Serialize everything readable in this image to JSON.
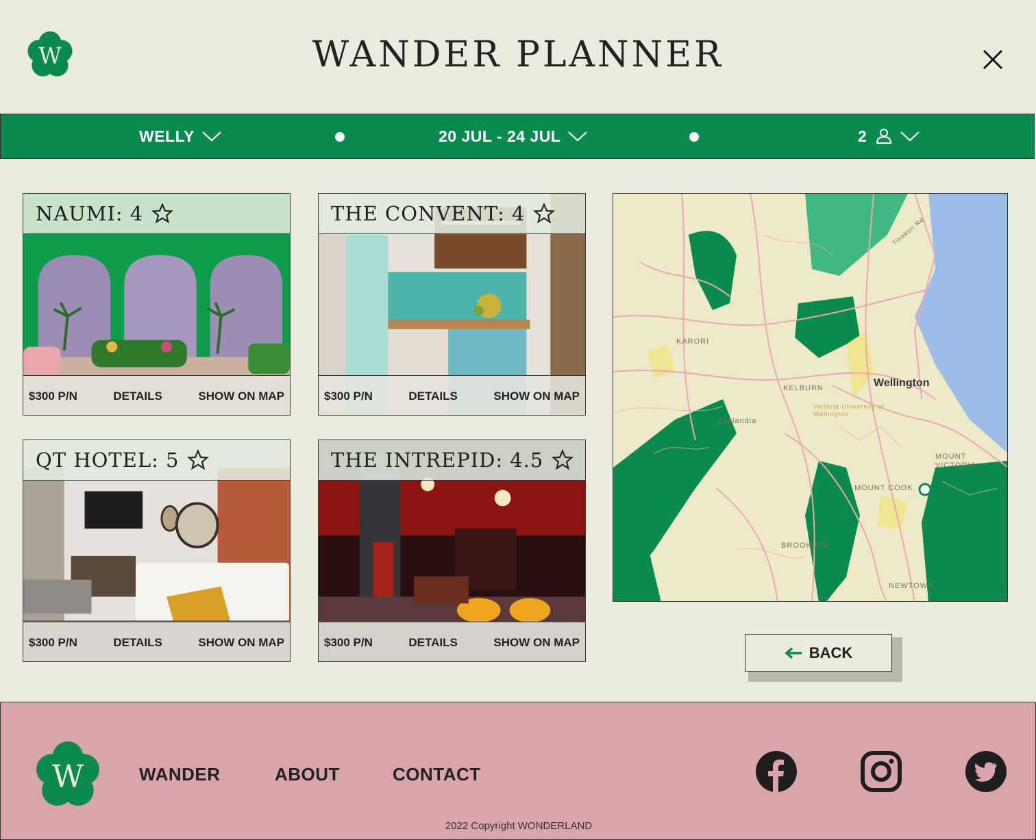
{
  "header": {
    "title": "WANDER PLANNER",
    "logo_letter": "W"
  },
  "search": {
    "location": "WELLY",
    "dates": "20 JUL - 24 JUL",
    "guests": "2"
  },
  "hotels": [
    {
      "name": "NAUMI:",
      "rating": "4",
      "price": "$300 P/N",
      "details": "DETAILS",
      "map": "SHOW ON MAP"
    },
    {
      "name": "THE CONVENT:",
      "rating": "4",
      "price": "$300 P/N",
      "details": "DETAILS",
      "map": "SHOW ON MAP"
    },
    {
      "name": "QT HOTEL:",
      "rating": "5",
      "price": "$300 P/N",
      "details": "DETAILS",
      "map": "SHOW ON MAP"
    },
    {
      "name": "THE INTREPID:",
      "rating": "4.5",
      "price": "$300 P/N",
      "details": "DETAILS",
      "map": "SHOW ON MAP"
    }
  ],
  "map": {
    "city": "Wellington",
    "labels": [
      "KARORI",
      "KELBURN",
      "BROOKLYN",
      "NEWTOWN",
      "MOUNT COOK",
      "MOUNT VICTORIA",
      "Zealandia",
      "Victoria University of Wellington",
      "Tinakori Rd"
    ]
  },
  "back_label": "BACK",
  "footer": {
    "logo_letter": "W",
    "nav": [
      "WANDER",
      "ABOUT",
      "CONTACT"
    ],
    "copyright": "2022 Copyright WONDERLAND"
  },
  "colors": {
    "brand_green": "#0a8a4e",
    "background": "#ecebe0",
    "footer_pink": "#d9a5ab",
    "map_road": "#e8a9b5",
    "map_park": "#0a8a4e",
    "map_water": "#9bbde8"
  },
  "icons": [
    "logo-flower-icon",
    "close-icon",
    "chevron-down-icon",
    "person-icon",
    "star-icon",
    "arrow-left-icon",
    "facebook-icon",
    "instagram-icon",
    "twitter-icon"
  ]
}
